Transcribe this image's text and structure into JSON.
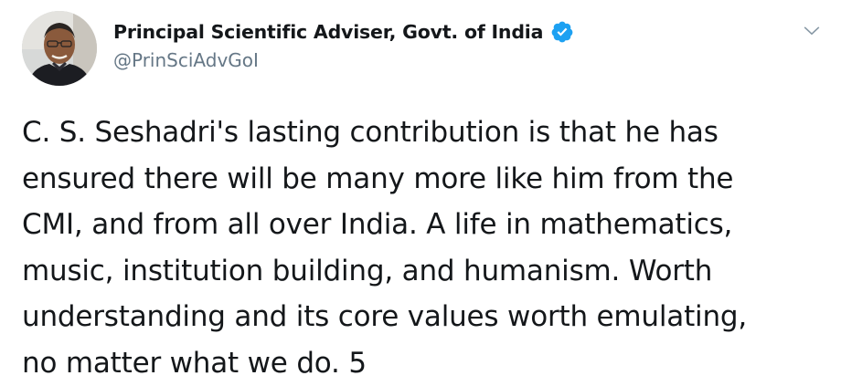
{
  "tweet": {
    "author": {
      "display_name": "Principal Scientific Adviser, Govt. of India",
      "handle": "@PrinSciAdvGoI",
      "verified": true,
      "avatar_icon": "profile-photo"
    },
    "text": "C. S. Seshadri's lasting contribution is that he has\nensured there will be many more like him from the\nCMI, and from all over India. A life in mathematics,\nmusic, institution building, and humanism. Worth\nunderstanding and its core values worth emulating,\nno matter what we do. 5",
    "menu_icon": "chevron-down-icon"
  },
  "colors": {
    "text_primary": "#14171a",
    "text_secondary": "#657786",
    "verified_blue": "#1da1f2",
    "background": "#ffffff"
  }
}
